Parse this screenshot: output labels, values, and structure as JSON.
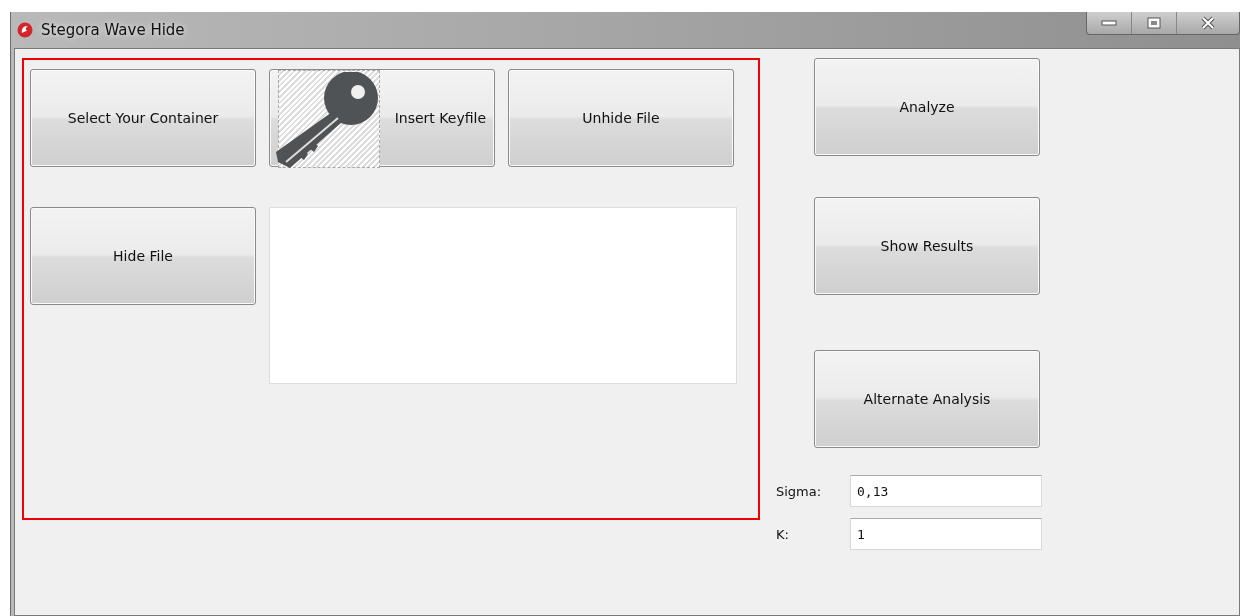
{
  "window": {
    "title": "Stegora Wave Hide"
  },
  "panel": {
    "buttons": [
      {
        "label": "Select Your Container",
        "kind": "plain"
      },
      {
        "label": "Insert Keyfile",
        "kind": "key"
      },
      {
        "label": "Unhide File",
        "kind": "plain"
      },
      {
        "label": "Hide File",
        "kind": "plain"
      }
    ]
  },
  "side_buttons": [
    {
      "label": "Analyze"
    },
    {
      "label": "Show Results"
    },
    {
      "label": "Alternate Analysis"
    }
  ],
  "fields": [
    {
      "label": "Sigma:",
      "value": "0,13"
    },
    {
      "label": "K:",
      "value": "1"
    }
  ]
}
